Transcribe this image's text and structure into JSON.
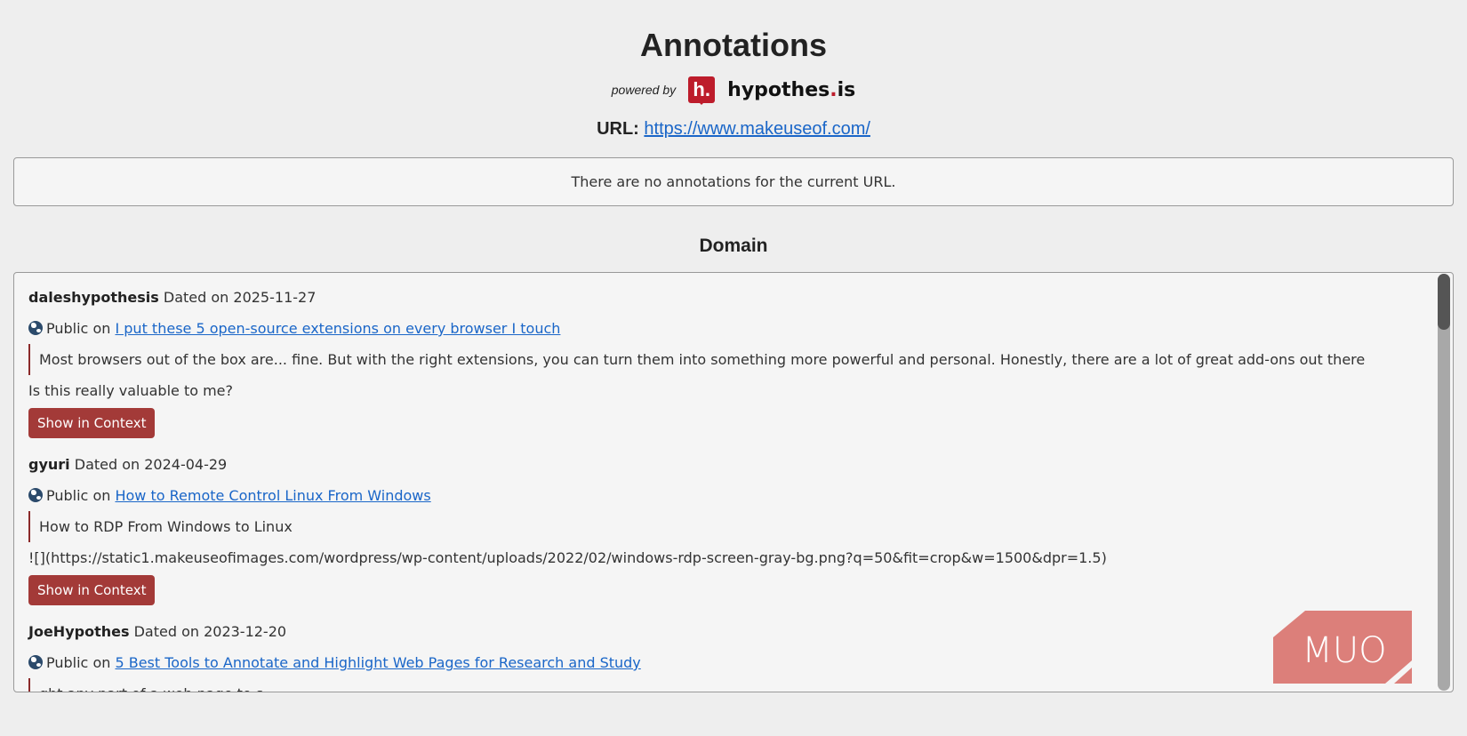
{
  "title": "Annotations",
  "powered_by": "powered by",
  "brand": {
    "logo_letter": "h.",
    "name_main": "hypothes",
    "name_dot": ".",
    "name_end": "is"
  },
  "url": {
    "label": "URL:",
    "value": "https://www.makeuseof.com/"
  },
  "notice": "There are no annotations for the current URL.",
  "domain_title": "Domain",
  "annotations": [
    {
      "user": "daleshypothesis",
      "dated": "Dated on 2025-11-27",
      "visibility": "Public on",
      "link": "I put these 5 open-source extensions on every browser I touch",
      "quote": "Most browsers out of the box are... fine. But with the right extensions, you can turn them into something more powerful and personal. Honestly, there are a lot of great add-ons out there",
      "text": "Is this really valuable to me?",
      "button": "Show in Context"
    },
    {
      "user": "gyuri",
      "dated": "Dated on 2024-04-29",
      "visibility": "Public on",
      "link": "How to Remote Control Linux From Windows",
      "quote": "How to RDP From Windows to Linux",
      "text": "![](https://static1.makeuseofimages.com/wordpress/wp-content/uploads/2022/02/windows-rdp-screen-gray-bg.png?q=50&fit=crop&w=1500&dpr=1.5)",
      "button": "Show in Context"
    },
    {
      "user": "JoeHypothes",
      "dated": "Dated on 2023-12-20",
      "visibility": "Public on",
      "link": "5 Best Tools to Annotate and Highlight Web Pages for Research and Study",
      "quote": "ght any part of a web page to s"
    }
  ],
  "watermark": "MUO"
}
